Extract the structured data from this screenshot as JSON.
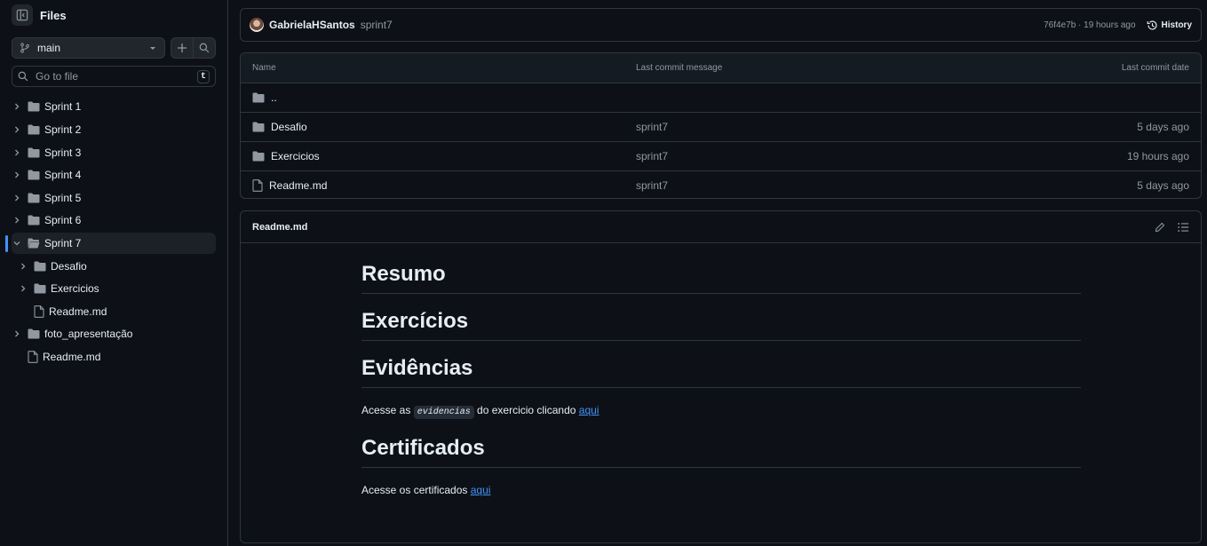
{
  "sidebar": {
    "title": "Files",
    "branch": "main",
    "goto_placeholder": "Go to file",
    "goto_shortcut": "t",
    "tree": [
      {
        "label": "Sprint 1",
        "type": "folder",
        "depth": 0,
        "expanded": false
      },
      {
        "label": "Sprint 2",
        "type": "folder",
        "depth": 0,
        "expanded": false
      },
      {
        "label": "Sprint 3",
        "type": "folder",
        "depth": 0,
        "expanded": false
      },
      {
        "label": "Sprint 4",
        "type": "folder",
        "depth": 0,
        "expanded": false
      },
      {
        "label": "Sprint 5",
        "type": "folder",
        "depth": 0,
        "expanded": false
      },
      {
        "label": "Sprint 6",
        "type": "folder",
        "depth": 0,
        "expanded": false
      },
      {
        "label": "Sprint 7",
        "type": "folder-open",
        "depth": 0,
        "expanded": true,
        "active": true
      },
      {
        "label": "Desafio",
        "type": "folder",
        "depth": 1,
        "expanded": false
      },
      {
        "label": "Exercicios",
        "type": "folder",
        "depth": 1,
        "expanded": false
      },
      {
        "label": "Readme.md",
        "type": "file",
        "depth": 1
      },
      {
        "label": "foto_apresentação",
        "type": "folder",
        "depth": 0,
        "expanded": false
      },
      {
        "label": "Readme.md",
        "type": "file",
        "depth": 0
      }
    ]
  },
  "commit": {
    "author": "GabrielaHSantos",
    "message": "sprint7",
    "meta": "76f4e7b · 19 hours ago",
    "history_label": "History"
  },
  "files": {
    "headers": {
      "name": "Name",
      "message": "Last commit message",
      "date": "Last commit date"
    },
    "parent": "..",
    "rows": [
      {
        "name": "Desafio",
        "type": "folder",
        "message": "sprint7",
        "date": "5 days ago"
      },
      {
        "name": "Exercicios",
        "type": "folder",
        "message": "sprint7",
        "date": "19 hours ago"
      },
      {
        "name": "Readme.md",
        "type": "file",
        "message": "sprint7",
        "date": "5 days ago"
      }
    ]
  },
  "readme": {
    "title": "Readme.md",
    "h_resumo": "Resumo",
    "h_exercicios": "Exercícios",
    "h_evidencias": "Evidências",
    "p1_pre": "Acesse as ",
    "p1_code": "evidencias",
    "p1_mid": " do exercicio clicando ",
    "p1_link": "aqui",
    "h_certificados": "Certificados",
    "p2_pre": "Acesse os certificados ",
    "p2_link": "aqui"
  },
  "colors": {
    "accent": "#4493f8",
    "bg": "#0d1117",
    "border": "#30363d",
    "muted": "#9198a1"
  }
}
